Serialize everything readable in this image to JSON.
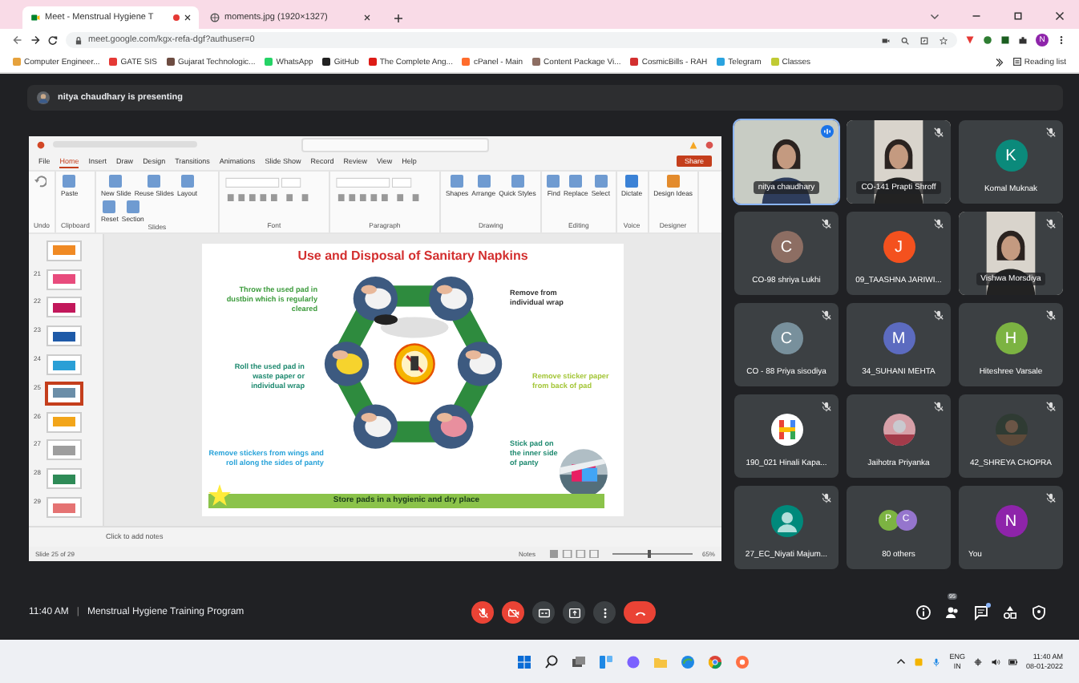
{
  "browser": {
    "tabs": [
      {
        "title": "Meet - Menstrual Hygiene T",
        "selected": true,
        "recording": true
      },
      {
        "title": "moments.jpg (1920×1327)",
        "selected": false,
        "recording": false
      }
    ],
    "url": "meet.google.com/kgx-refa-dgf?authuser=0",
    "profile": "N",
    "bookmarks": [
      {
        "label": "Computer Engineer...",
        "color": "#e6a23c"
      },
      {
        "label": "GATE SIS",
        "color": "#e53935"
      },
      {
        "label": "Gujarat Technologic...",
        "color": "#6d4c41"
      },
      {
        "label": "WhatsApp",
        "color": "#25d366"
      },
      {
        "label": "GitHub",
        "color": "#222222"
      },
      {
        "label": "The Complete Ang...",
        "color": "#dd1b16"
      },
      {
        "label": "cPanel - Main",
        "color": "#ff6c2c"
      },
      {
        "label": "Content Package Vi...",
        "color": "#8d6e63"
      },
      {
        "label": "CosmicBills - RAH",
        "color": "#d32f2f"
      },
      {
        "label": "Telegram",
        "color": "#2aa3df"
      },
      {
        "label": "Classes",
        "color": "#c0ca33"
      }
    ],
    "reading_list": "Reading list"
  },
  "presenting_banner": "nitya chaudhary is presenting",
  "powerpoint": {
    "menu": [
      {
        "label": "File",
        "selected": false
      },
      {
        "label": "Home",
        "selected": true
      },
      {
        "label": "Insert",
        "selected": false
      },
      {
        "label": "Draw",
        "selected": false
      },
      {
        "label": "Design",
        "selected": false
      },
      {
        "label": "Transitions",
        "selected": false
      },
      {
        "label": "Animations",
        "selected": false
      },
      {
        "label": "Slide Show",
        "selected": false
      },
      {
        "label": "Record",
        "selected": false
      },
      {
        "label": "Review",
        "selected": false
      },
      {
        "label": "View",
        "selected": false
      },
      {
        "label": "Help",
        "selected": false
      }
    ],
    "share": "Share",
    "ribbon": [
      {
        "label": "Undo",
        "kind": "buttons"
      },
      {
        "label": "Clipboard",
        "kind": "buttons",
        "buttons": [
          "Paste"
        ]
      },
      {
        "label": "Slides",
        "kind": "buttons",
        "buttons": [
          "New Slide",
          "Reuse Slides",
          "Layout",
          "Reset",
          "Section"
        ]
      },
      {
        "label": "Font",
        "kind": "controls"
      },
      {
        "label": "Paragraph",
        "kind": "controls"
      },
      {
        "label": "Drawing",
        "kind": "buttons",
        "buttons": [
          "Shapes",
          "Arrange",
          "Quick Styles"
        ]
      },
      {
        "label": "Editing",
        "kind": "buttons",
        "buttons": [
          "Find",
          "Replace",
          "Select"
        ]
      },
      {
        "label": "Voice",
        "kind": "buttons",
        "buttons": [
          "Dictate"
        ]
      },
      {
        "label": "Designer",
        "kind": "buttons",
        "buttons": [
          "Design Ideas"
        ]
      }
    ],
    "thumbnails": [
      {
        "color": "#f08a24",
        "selected": false
      },
      {
        "number": "21",
        "color": "#e84c7d",
        "selected": false
      },
      {
        "number": "22",
        "color": "#c2185b",
        "selected": false
      },
      {
        "number": "23",
        "color": "#1e5aa8",
        "selected": false
      },
      {
        "number": "24",
        "color": "#2a9fd6",
        "selected": false
      },
      {
        "number": "25",
        "color": "#6b8ea8",
        "selected": true
      },
      {
        "number": "26",
        "color": "#f2a51a",
        "selected": false
      },
      {
        "number": "27",
        "color": "#9e9e9e",
        "selected": false
      },
      {
        "number": "28",
        "color": "#2e8b57",
        "selected": false
      },
      {
        "number": "29",
        "color": "#e57373",
        "selected": false
      }
    ],
    "slide": {
      "title": "Use and Disposal of Sanitary Napkins",
      "captions": [
        {
          "text": "Throw the used pad in dustbin which is regularly cleared",
          "color": "#3c9b3c"
        },
        {
          "text": "Remove from individual wrap",
          "color": "#333333"
        },
        {
          "text": "Roll the used pad in waste paper or individual wrap",
          "color": "#1f8a70"
        },
        {
          "text": "Remove sticker paper from back of pad",
          "color": "#a4c639"
        },
        {
          "text": "Remove stickers from wings and roll along the sides of panty",
          "color": "#29a3d9"
        },
        {
          "text": "Stick pad on the inner side of panty",
          "color": "#1f8a70"
        }
      ],
      "banner": "Store pads in a hygienic and dry place"
    },
    "notes_placeholder": "Click to add notes",
    "status": "Slide 25 of 29",
    "notes_button": "Notes",
    "zoom": "65%",
    "zoom_slider": {
      "level": 0.45
    }
  },
  "participants": [
    {
      "kind": "video",
      "name": "nitya chaudhary",
      "speaking": true
    },
    {
      "kind": "video",
      "name": "CO-141 Prapti Shroff",
      "muted": true,
      "speaking": false
    },
    {
      "kind": "letter",
      "name": "Komal Muknak",
      "initial": "K",
      "color": "#0b8a7b",
      "muted": true,
      "speaking": false
    },
    {
      "kind": "letter",
      "name": "CO-98 shriya Lukhi",
      "initial": "C",
      "color": "#8d6e63",
      "muted": true,
      "speaking": false
    },
    {
      "kind": "letter",
      "name": "09_TAASHNA JARIWI...",
      "initial": "J",
      "color": "#f4511e",
      "muted": true,
      "speaking": false
    },
    {
      "kind": "video",
      "name": "Vishwa Morsdiya",
      "muted": true,
      "speaking": false
    },
    {
      "kind": "letter",
      "name": "CO - 88 Priya sisodiya",
      "initial": "C",
      "color": "#78909c",
      "muted": true,
      "speaking": false
    },
    {
      "kind": "letter",
      "name": "34_SUHANI MEHTA",
      "initial": "M",
      "color": "#5c6bc0",
      "muted": true,
      "speaking": false
    },
    {
      "kind": "letter",
      "name": "Hiteshree Varsale",
      "initial": "H",
      "color": "#7cb342",
      "muted": true,
      "speaking": false
    },
    {
      "kind": "logo",
      "name": "190_021 Hinali Kapa...",
      "muted": true,
      "speaking": false
    },
    {
      "name": "Jaihotra Priyanka",
      "muted": true,
      "speaking": false
    },
    {
      "name": "42_SHREYA CHOPRA",
      "muted": true,
      "speaking": false
    },
    {
      "kind": "silhouette",
      "name": "27_EC_Niyati Majum...",
      "muted": true,
      "speaking": false
    },
    {
      "kind": "others",
      "name": "80 others",
      "initials": [
        {
          "letter": "P",
          "color": "#7cb342"
        },
        {
          "letter": "C",
          "color": "#9575cd"
        }
      ]
    },
    {
      "kind": "letter",
      "name": "You",
      "initial": "N",
      "color": "#8e24aa",
      "muted": true,
      "speaking": false
    }
  ],
  "meeting": {
    "time": "11:40 AM",
    "separator": "|",
    "title": "Menstrual Hygiene Training Program",
    "controls": [
      {
        "kind": "mic",
        "on": false
      },
      {
        "kind": "camera",
        "on": false
      },
      {
        "kind": "captions"
      },
      {
        "kind": "present"
      },
      {
        "kind": "more"
      },
      {
        "kind": "hangup"
      }
    ],
    "people_count": "95",
    "chat_unread": true
  },
  "taskbar": {
    "language": "ENG",
    "region": "IN",
    "time": "11:40 AM",
    "date": "08-01-2022"
  }
}
